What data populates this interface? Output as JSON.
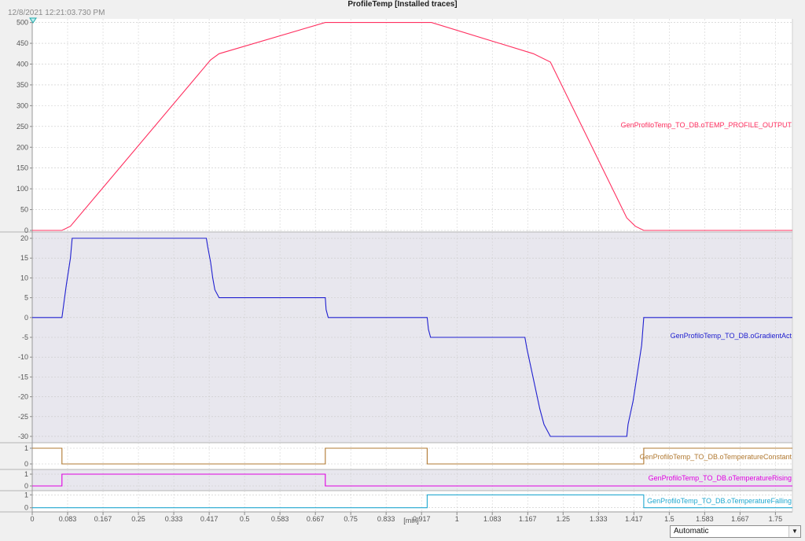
{
  "window": {
    "title": "ProfileTemp [Installed traces]",
    "timestamp": "12/8/2021  12:21:03.730 PM"
  },
  "controls": {
    "scaling_mode": "Automatic",
    "dropdown_icon": "triangle-down-icon"
  },
  "chart_data": {
    "type": "line",
    "xlabel": "[min]",
    "xlim": [
      0,
      1.79
    ],
    "x_ticks": [
      "0",
      "0.083",
      "0.167",
      "0.25",
      "0.333",
      "0.417",
      "0.5",
      "0.583",
      "0.667",
      "0.75",
      "0.833",
      "0.917",
      "1",
      "1.083",
      "1.167",
      "1.25",
      "1.333",
      "1.417",
      "1.5",
      "1.583",
      "1.667",
      "1.75"
    ],
    "x_tick_values": [
      0,
      0.0833,
      0.1667,
      0.25,
      0.3333,
      0.4167,
      0.5,
      0.5833,
      0.6667,
      0.75,
      0.8333,
      0.9167,
      1,
      1.0833,
      1.1667,
      1.25,
      1.3333,
      1.4167,
      1.5,
      1.5833,
      1.6667,
      1.75
    ],
    "panels": [
      {
        "series_name": "GenProfiloTemp_TO_DB.oTEMP_PROFILE_OUTPUT",
        "color": "#ff3060",
        "ylim": [
          0,
          505
        ],
        "y_ticks": [
          0,
          50,
          100,
          150,
          200,
          250,
          300,
          350,
          400,
          450,
          500
        ],
        "x": [
          0,
          0.07,
          0.09,
          0.42,
          0.44,
          0.69,
          0.94,
          1.18,
          1.22,
          1.4,
          1.42,
          1.44,
          1.79
        ],
        "y": [
          0,
          0,
          10,
          410,
          425,
          500,
          500,
          425,
          405,
          30,
          10,
          0,
          0
        ]
      },
      {
        "series_name": "GenProfiloTemp_TO_DB.oGradientAct",
        "color": "#2020d0",
        "ylim": [
          -31,
          21
        ],
        "y_ticks": [
          20,
          15,
          10,
          5,
          0,
          -5,
          -10,
          -15,
          -20,
          -25,
          -30
        ],
        "x": [
          0,
          0.07,
          0.08,
          0.09,
          0.094,
          0.41,
          0.413,
          0.42,
          0.425,
          0.43,
          0.44,
          0.69,
          0.692,
          0.697,
          0.93,
          0.933,
          0.938,
          1.16,
          1.165,
          1.175,
          1.185,
          1.195,
          1.205,
          1.22,
          1.4,
          1.403,
          1.415,
          1.425,
          1.435,
          1.44,
          1.79
        ],
        "y": [
          0,
          0,
          8,
          15,
          20,
          20,
          18,
          14,
          10,
          7,
          5,
          5,
          2,
          0,
          0,
          -3,
          -5,
          -5,
          -8,
          -13,
          -18,
          -23,
          -27,
          -30,
          -30,
          -27,
          -21,
          -14,
          -7,
          0,
          0
        ]
      },
      {
        "series_name": "GenProfiloTemp_TO_DB.oTemperatureConstant",
        "color": "#b07830",
        "ylim": [
          -0.2,
          1.2
        ],
        "y_ticks": [
          1,
          0
        ],
        "x": [
          0,
          0.07,
          0.07,
          0.69,
          0.69,
          0.93,
          0.93,
          1.44,
          1.44,
          1.79
        ],
        "y": [
          1,
          1,
          0,
          0,
          1,
          1,
          0,
          0,
          1,
          1
        ]
      },
      {
        "series_name": "GenProfiloTemp_TO_DB.oTemperatureRising",
        "color": "#e000e0",
        "ylim": [
          -0.2,
          1.2
        ],
        "y_ticks": [
          1,
          0
        ],
        "x": [
          0,
          0.07,
          0.07,
          0.69,
          0.69,
          1.79
        ],
        "y": [
          0,
          0,
          1,
          1,
          0,
          0
        ]
      },
      {
        "series_name": "GenProfiloTemp_TO_DB.oTemperatureFalling",
        "color": "#20a8d0",
        "ylim": [
          -0.2,
          1.2
        ],
        "y_ticks": [
          1,
          0
        ],
        "x": [
          0,
          0.93,
          0.93,
          1.44,
          1.44,
          1.79
        ],
        "y": [
          0,
          0,
          1,
          1,
          0,
          0
        ]
      }
    ]
  }
}
